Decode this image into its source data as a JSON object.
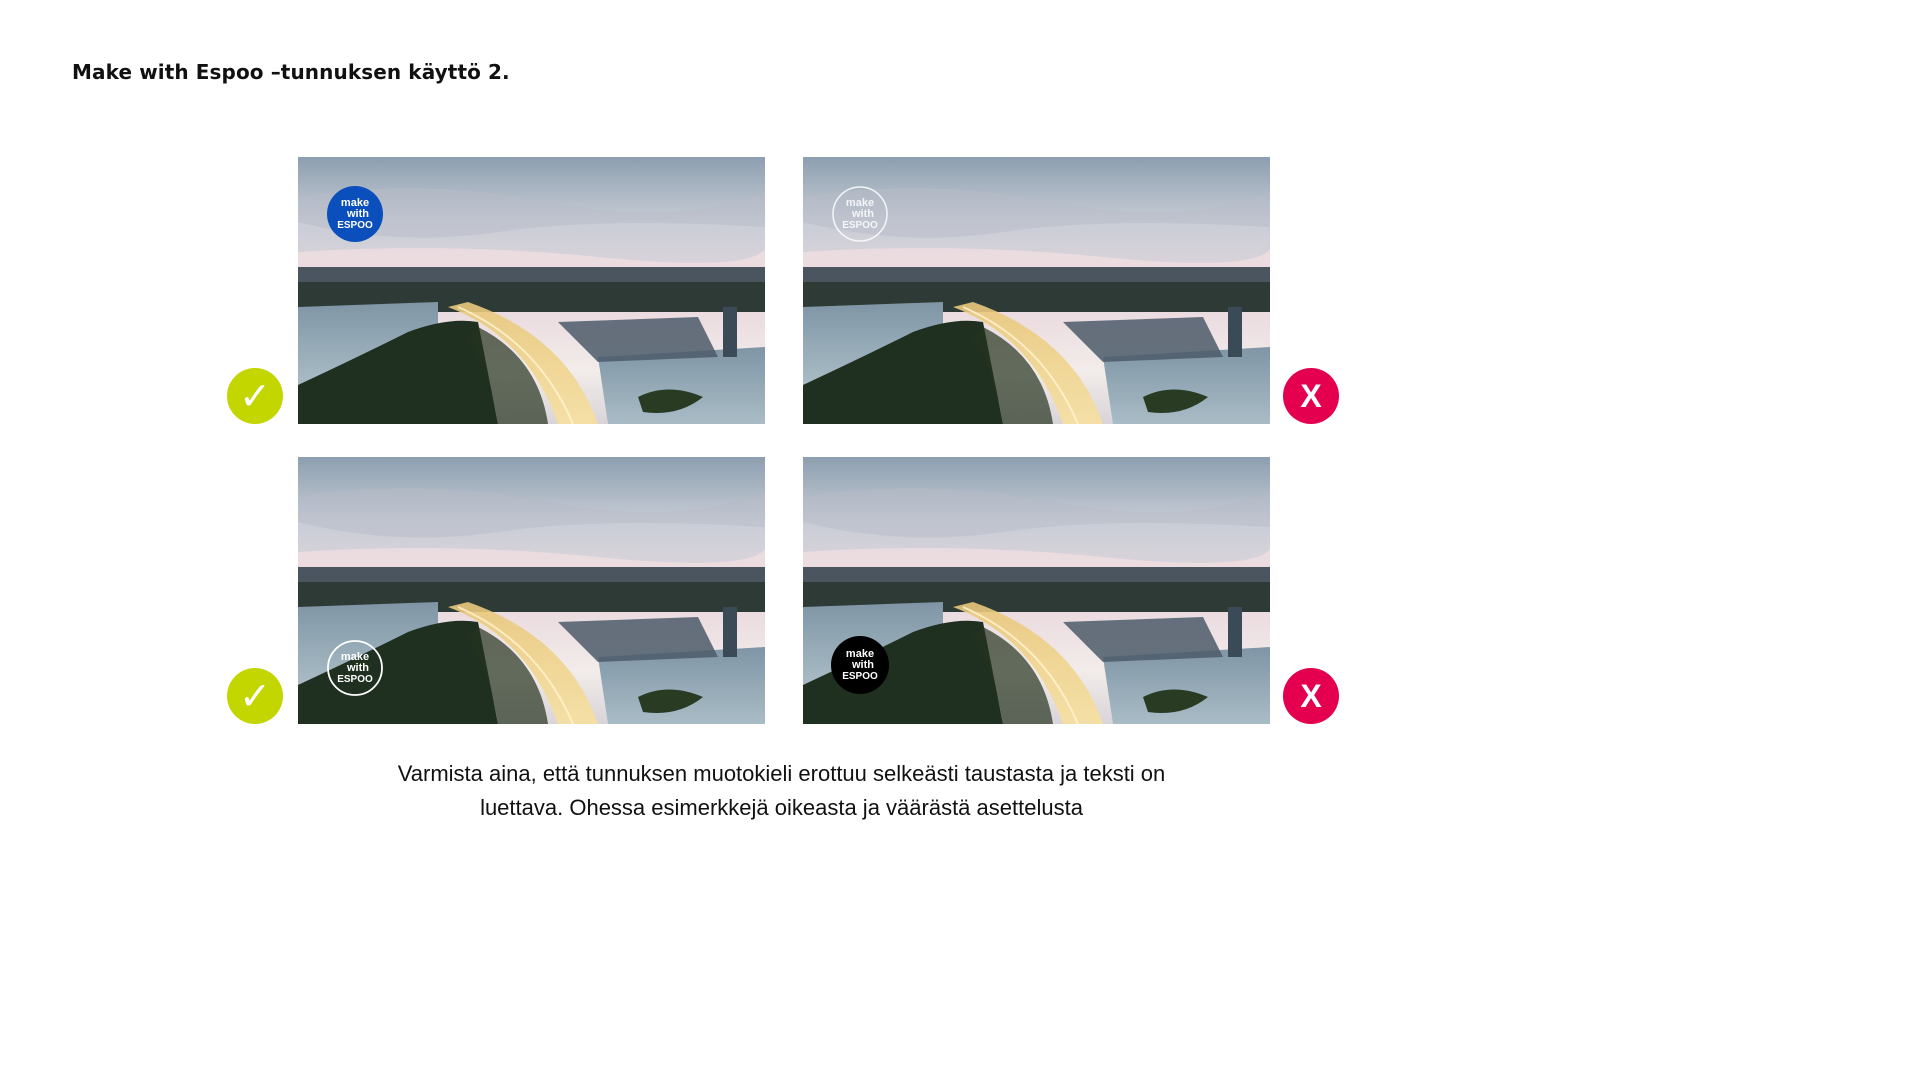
{
  "title": "Make with Espoo –tunnuksen käyttö 2.",
  "logo": {
    "line1": "make",
    "line2": "with",
    "line3": "ESPOO"
  },
  "examples": [
    {
      "verdict": "correct",
      "mark": "✓",
      "logo_style": "blue filled",
      "logo_fill": "#0b4fbc"
    },
    {
      "verdict": "incorrect",
      "mark": "X",
      "logo_style": "white outline, low contrast"
    },
    {
      "verdict": "correct",
      "mark": "✓",
      "logo_style": "white outline"
    },
    {
      "verdict": "incorrect",
      "mark": "X",
      "logo_style": "black filled",
      "logo_fill": "#000000"
    }
  ],
  "caption": {
    "line1": "Varmista aina, että tunnuksen muotokieli erottuu selkeästi taustasta ja teksti on",
    "line2": "luettava. Ohessa esimerkkejä oikeasta ja väärästä asettelusta"
  },
  "colors": {
    "correct": "#c4d600",
    "incorrect": "#e4004f",
    "logo_blue": "#0b4fbc"
  }
}
